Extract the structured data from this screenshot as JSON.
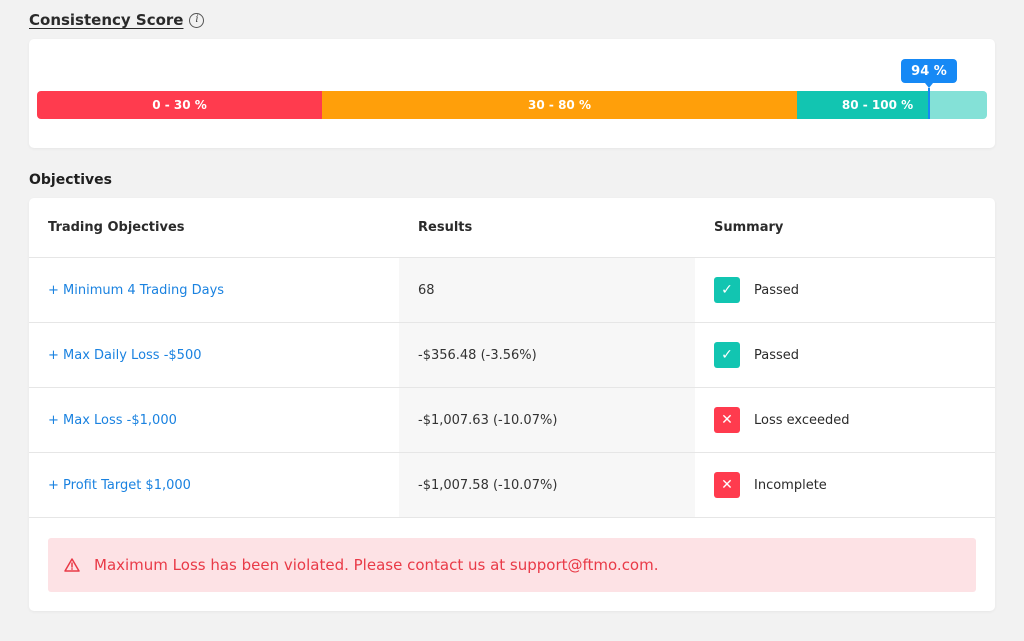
{
  "consistency": {
    "title": "Consistency Score",
    "info_icon": "i",
    "segments": [
      {
        "label": "0 - 30 %",
        "color": "#ff3b4e"
      },
      {
        "label": "30 - 80 %",
        "color": "#ff9f0a"
      },
      {
        "label": "80 - 100 %",
        "color": "#12c5b1"
      }
    ],
    "score_label": "94 %",
    "score_value": 94,
    "marker_color": "#1689f5"
  },
  "objectives": {
    "title": "Objectives",
    "headers": {
      "objective": "Trading Objectives",
      "results": "Results",
      "summary": "Summary"
    },
    "rows": [
      {
        "objective": "+ Minimum 4 Trading Days",
        "result": "68",
        "summary": "Passed",
        "status": "passed",
        "icon": "check-icon"
      },
      {
        "objective": "+ Max Daily Loss -$500",
        "result": "-$356.48 (-3.56%)",
        "summary": "Passed",
        "status": "passed",
        "icon": "check-icon"
      },
      {
        "objective": "+ Max Loss -$1,000",
        "result": "-$1,007.63 (-10.07%)",
        "summary": "Loss exceeded",
        "status": "failed",
        "icon": "x-icon"
      },
      {
        "objective": "+ Profit Target $1,000",
        "result": "-$1,007.58 (-10.07%)",
        "summary": "Incomplete",
        "status": "failed",
        "icon": "x-icon"
      }
    ],
    "alert": {
      "icon": "warning-icon",
      "text": "Maximum Loss has been violated. Please contact us at support@ftmo.com."
    },
    "colors": {
      "link": "#1a82e0",
      "passed": "#12c5b1",
      "failed": "#ff3b4e",
      "alert_bg": "#fde2e5",
      "alert_text": "#e93a47"
    }
  }
}
